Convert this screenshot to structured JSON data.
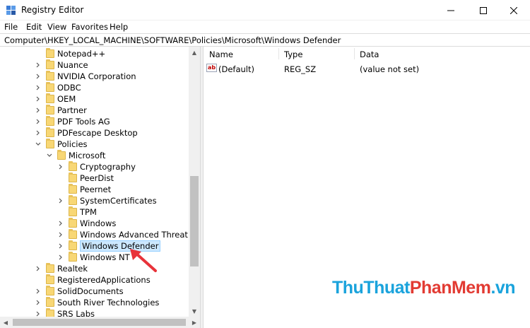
{
  "window": {
    "title": "Registry Editor"
  },
  "menu": [
    "File",
    "Edit",
    "View",
    "Favorites",
    "Help"
  ],
  "address": "Computer\\HKEY_LOCAL_MACHINE\\SOFTWARE\\Policies\\Microsoft\\Windows Defender",
  "tree": {
    "items": [
      {
        "label": "Notepad++",
        "level": 1,
        "chevron": "none"
      },
      {
        "label": "Nuance",
        "level": 1,
        "chevron": "right"
      },
      {
        "label": "NVIDIA Corporation",
        "level": 1,
        "chevron": "right"
      },
      {
        "label": "ODBC",
        "level": 1,
        "chevron": "right"
      },
      {
        "label": "OEM",
        "level": 1,
        "chevron": "right"
      },
      {
        "label": "Partner",
        "level": 1,
        "chevron": "right"
      },
      {
        "label": "PDF Tools AG",
        "level": 1,
        "chevron": "right"
      },
      {
        "label": "PDFescape Desktop",
        "level": 1,
        "chevron": "right"
      },
      {
        "label": "Policies",
        "level": 1,
        "chevron": "down"
      },
      {
        "label": "Microsoft",
        "level": 2,
        "chevron": "down"
      },
      {
        "label": "Cryptography",
        "level": 3,
        "chevron": "right"
      },
      {
        "label": "PeerDist",
        "level": 3,
        "chevron": "none"
      },
      {
        "label": "Peernet",
        "level": 3,
        "chevron": "none"
      },
      {
        "label": "SystemCertificates",
        "level": 3,
        "chevron": "right"
      },
      {
        "label": "TPM",
        "level": 3,
        "chevron": "none"
      },
      {
        "label": "Windows",
        "level": 3,
        "chevron": "right"
      },
      {
        "label": "Windows Advanced Threat Protec",
        "level": 3,
        "chevron": "right"
      },
      {
        "label": "Windows Defender",
        "level": 3,
        "chevron": "right",
        "selected": true
      },
      {
        "label": "Windows NT",
        "level": 3,
        "chevron": "right"
      },
      {
        "label": "Realtek",
        "level": 1,
        "chevron": "right"
      },
      {
        "label": "RegisteredApplications",
        "level": 1,
        "chevron": "none"
      },
      {
        "label": "SolidDocuments",
        "level": 1,
        "chevron": "right"
      },
      {
        "label": "South River Technologies",
        "level": 1,
        "chevron": "right"
      },
      {
        "label": "SRS Labs",
        "level": 1,
        "chevron": "right"
      }
    ]
  },
  "list": {
    "columns": {
      "name": "Name",
      "type": "Type",
      "data": "Data"
    },
    "rows": [
      {
        "name": "(Default)",
        "type": "REG_SZ",
        "data": "(value not set)",
        "icon": "string-value-icon",
        "icon_text": "ab"
      }
    ]
  },
  "watermark": {
    "part1": "ThuThuat",
    "part2": "PhanMem",
    "part3": ".vn"
  },
  "colors": {
    "selection": "#cce8ff",
    "folder": "#f8d775",
    "arrow": "#e8333a"
  }
}
